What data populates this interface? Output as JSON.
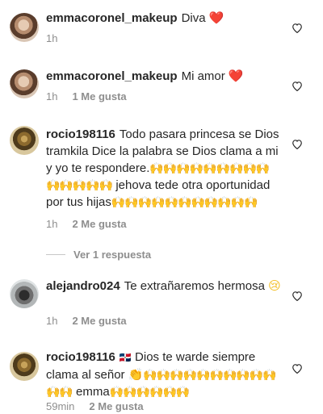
{
  "colors": {
    "text": "#262626",
    "muted": "#8e8e8e",
    "heart": "#e0162b",
    "emoji_yellow": "#f2bc1f"
  },
  "comments": [
    {
      "username": "emmacoronel_makeup",
      "text": "Diva",
      "heart": "❤️",
      "time": "1h",
      "likes": ""
    },
    {
      "username": "emmacoronel_makeup",
      "text": "Mi amor",
      "heart": "❤️",
      "time": "1h",
      "likes": "1 Me gusta"
    },
    {
      "username": "rocio198116",
      "text_1": "Todo pasara princesa se Dios tramkila Dice la palabra se Dios clama a mi y yo te respondere.",
      "hands_1": "🙌🙌🙌🙌🙌🙌🙌🙌🙌🙌🙌🙌🙌🙌",
      "text_2": "jehova tede otra oportunidad por tus hijas",
      "hands_2": "🙌🙌🙌🙌🙌🙌🙌🙌🙌🙌🙌",
      "time": "1h",
      "likes": "2 Me gusta",
      "replies": "Ver 1 respuesta"
    },
    {
      "username": "alejandro024",
      "text": "Te extrañaremos hermosa",
      "emoji": "😢",
      "time": "1h",
      "likes": "2 Me gusta"
    },
    {
      "username": "rocio198116",
      "flag": "🇩🇴",
      "text_1": "Dios te warde siempre clama al señor",
      "clap": "👏",
      "hands_1": "🙌🙌🙌🙌🙌🙌🙌🙌🙌🙌🙌🙌",
      "text_2": "emma",
      "hands_2": "🙌🙌🙌🙌🙌🙌",
      "time": "59min",
      "likes": "2 Me gusta"
    }
  ],
  "icons": {
    "avatar": "avatar-image",
    "like": "heart-outline-icon"
  }
}
